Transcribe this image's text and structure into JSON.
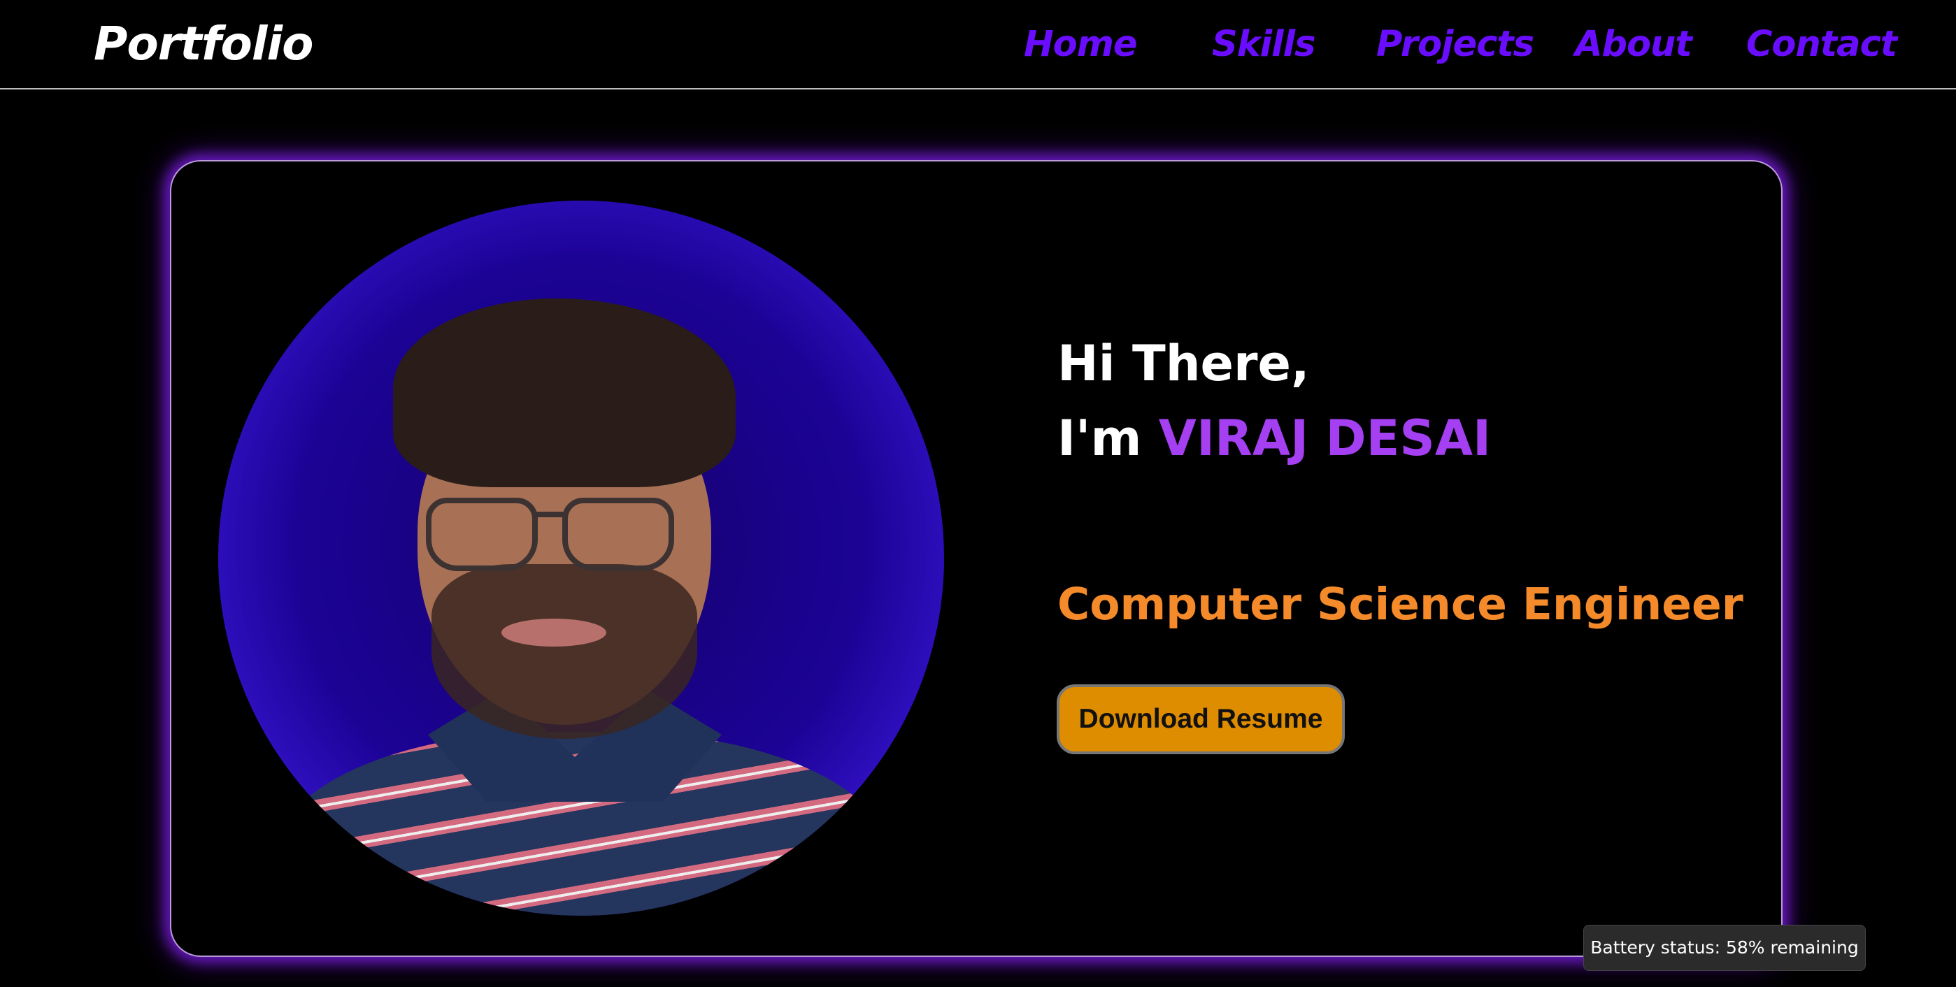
{
  "navbar": {
    "logo": "Portfolio",
    "links": [
      {
        "label": "Home"
      },
      {
        "label": "Skills"
      },
      {
        "label": "Projects"
      },
      {
        "label": "About"
      },
      {
        "label": "Contact"
      }
    ]
  },
  "hero": {
    "greeting": "Hi There,",
    "intro_prefix": "I'm ",
    "name": "VIRAJ DESAI",
    "subtitle": "Computer Science Engineer",
    "resume_button": "Download Resume",
    "avatar_icon": "profile-photo"
  },
  "tooltip": {
    "text": "Battery status: 58% remaining"
  },
  "colors": {
    "background": "#000000",
    "nav_link": "#6a0dff",
    "name_accent": "#a43ff2",
    "subtitle": "#f48a2a",
    "button": "#de8c00",
    "glow": "#7d1ee6"
  }
}
